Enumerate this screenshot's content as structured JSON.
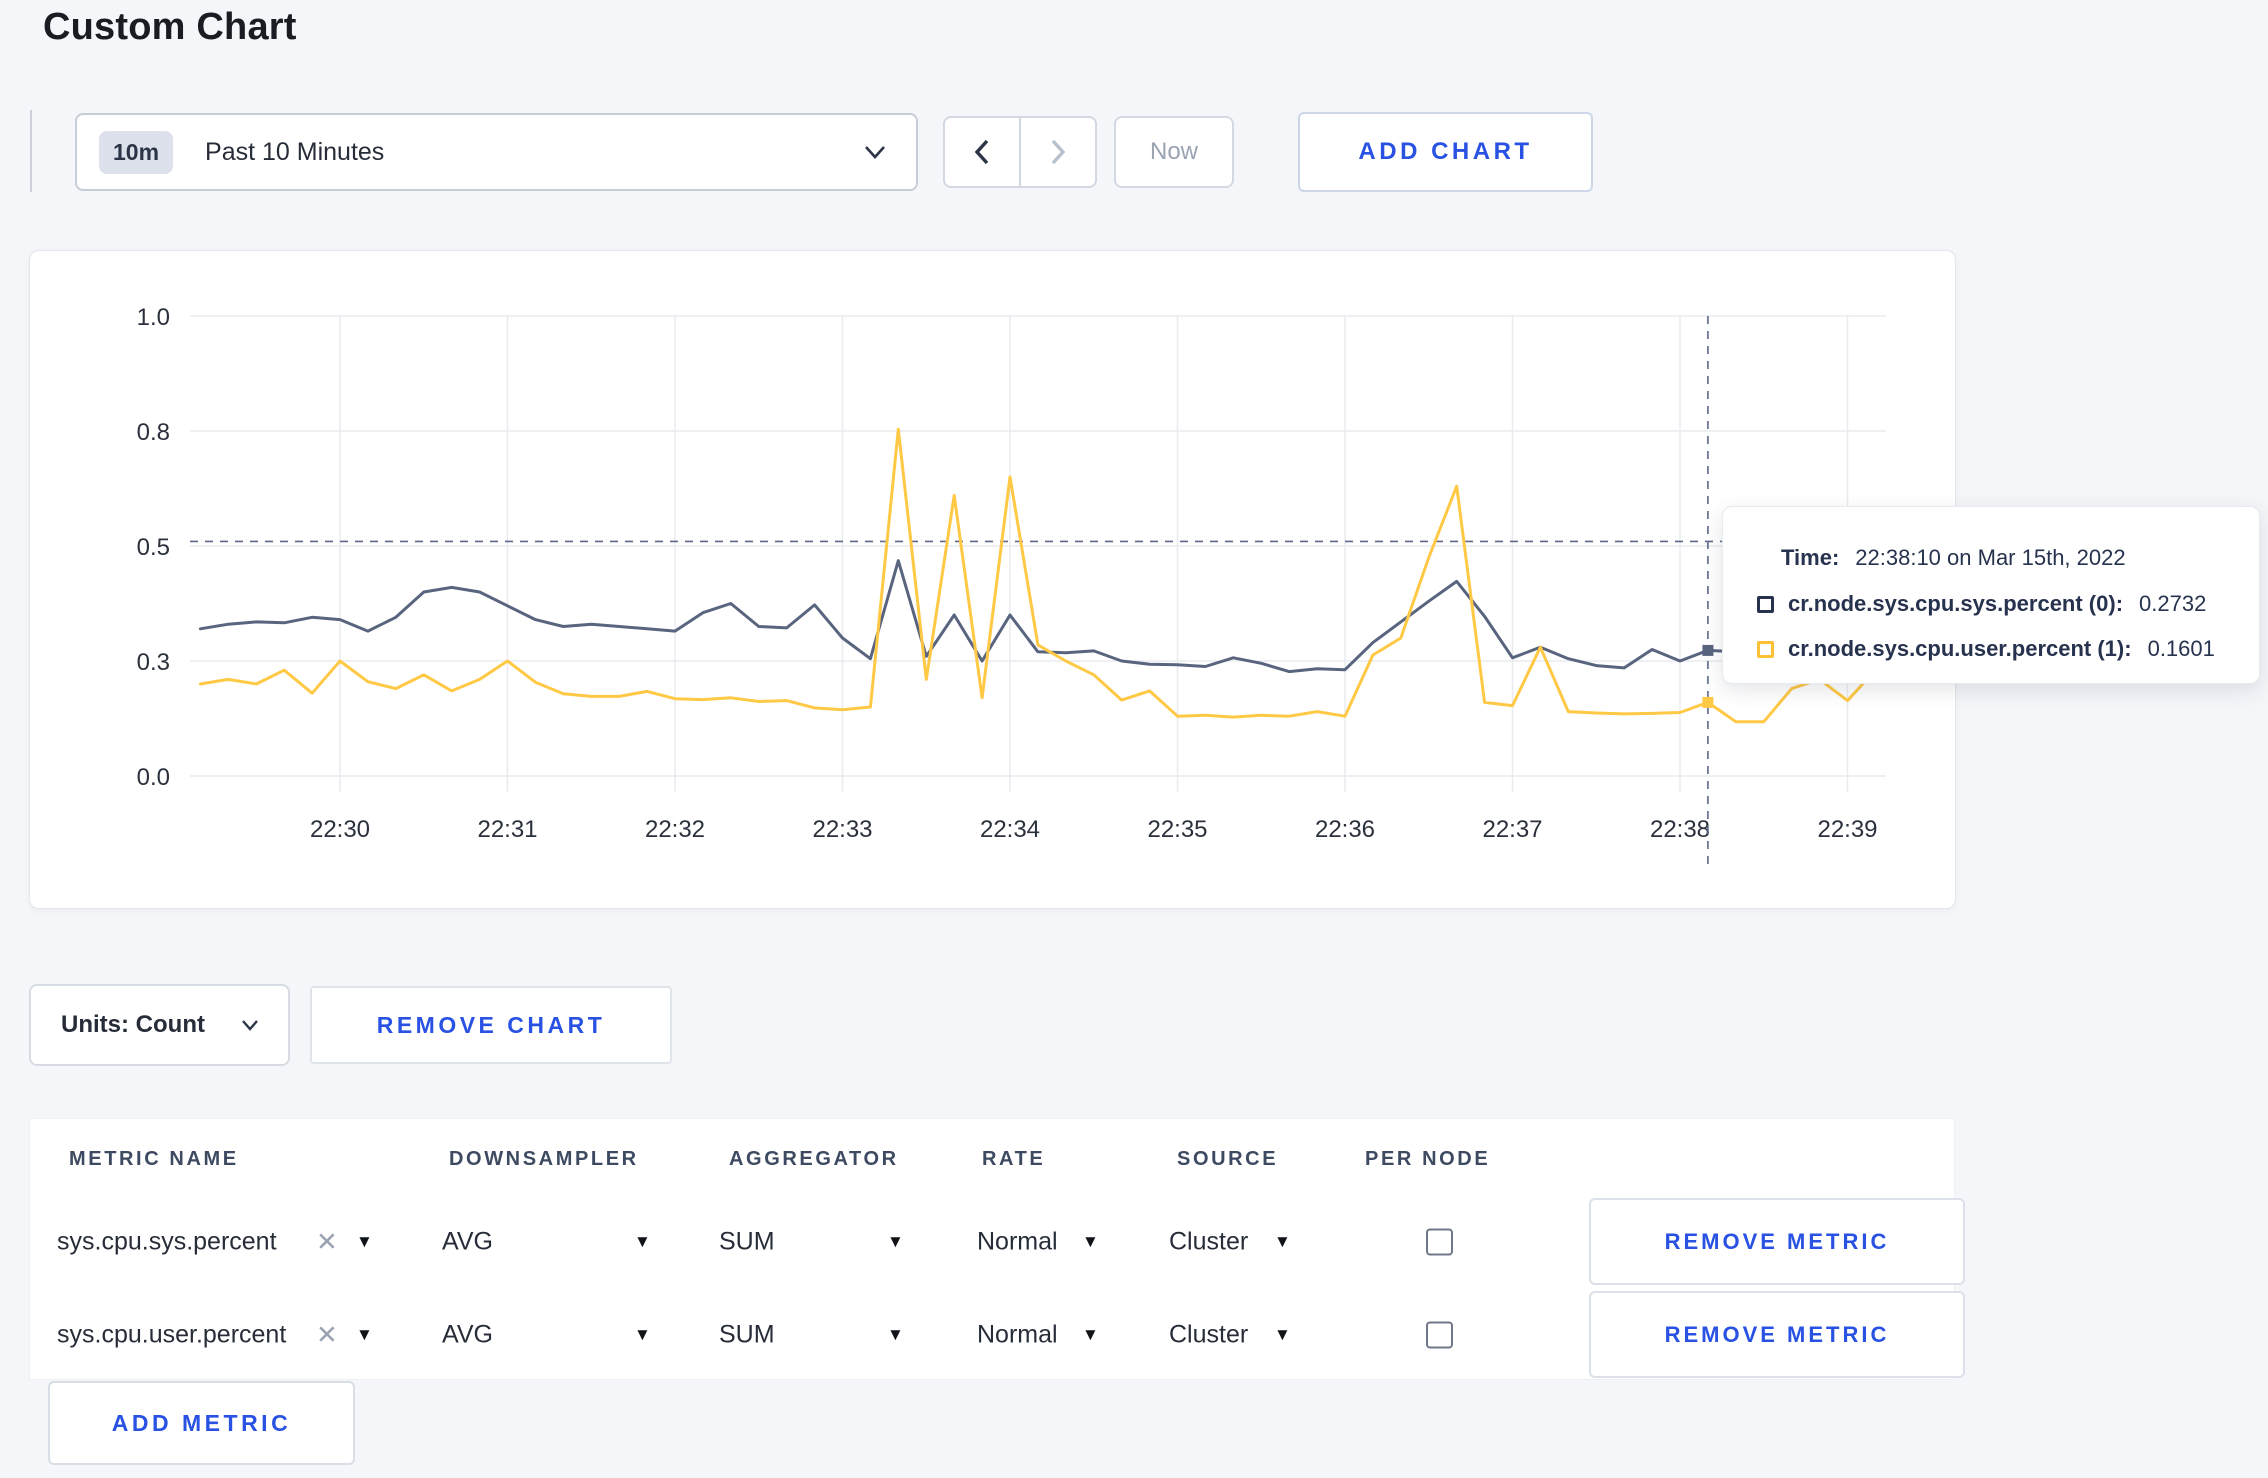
{
  "page": {
    "title": "Custom Chart"
  },
  "toolbar": {
    "time_badge": "10m",
    "time_label": "Past 10 Minutes",
    "now_label": "Now",
    "add_chart_label": "ADD CHART",
    "icons": {
      "prev": "chevron-left",
      "next": "chevron-right",
      "open": "chevron-down"
    }
  },
  "units_bar": {
    "units_label": "Units: Count",
    "remove_chart_label": "REMOVE CHART"
  },
  "chart_data": {
    "type": "line",
    "title": "",
    "xlabel": "",
    "ylabel": "",
    "ylim": [
      0,
      1
    ],
    "grid": true,
    "x_axis": {
      "labels": [
        "22:30",
        "22:31",
        "22:32",
        "22:33",
        "22:34",
        "22:35",
        "22:36",
        "22:37",
        "22:38",
        "22:39"
      ]
    },
    "y_axis": {
      "ticks": [
        {
          "label": "1.0",
          "value": 1.0
        },
        {
          "label": "0.8",
          "value": 0.75
        },
        {
          "label": "0.5",
          "value": 0.5
        },
        {
          "label": "0.3",
          "value": 0.25
        },
        {
          "label": "0.0",
          "value": 0.0
        }
      ]
    },
    "sample_interval_seconds": 10,
    "start_time": "22:29:10",
    "crosshair": {
      "index": 54,
      "time": "22:38:10",
      "hline_value": 0.51
    },
    "series": [
      {
        "key": "sys",
        "name": "cr.node.sys.cpu.sys.percent (0)",
        "color": "#59647e",
        "values": [
          0.32,
          0.33,
          0.335,
          0.333,
          0.345,
          0.34,
          0.315,
          0.345,
          0.4,
          0.41,
          0.4,
          0.37,
          0.34,
          0.325,
          0.33,
          0.325,
          0.32,
          0.315,
          0.355,
          0.375,
          0.325,
          0.322,
          0.372,
          0.3,
          0.255,
          0.468,
          0.26,
          0.35,
          0.25,
          0.35,
          0.27,
          0.268,
          0.272,
          0.25,
          0.243,
          0.242,
          0.238,
          0.257,
          0.245,
          0.227,
          0.233,
          0.231,
          0.29,
          0.335,
          0.38,
          0.423,
          0.347,
          0.257,
          0.28,
          0.255,
          0.24,
          0.235,
          0.275,
          0.25,
          0.273,
          0.27,
          0.27,
          0.28,
          0.29,
          0.3,
          0.31
        ]
      },
      {
        "key": "user",
        "name": "cr.node.sys.cpu.user.percent (1)",
        "color": "#ffc845",
        "values": [
          0.2,
          0.21,
          0.2,
          0.23,
          0.18,
          0.25,
          0.205,
          0.19,
          0.22,
          0.185,
          0.21,
          0.25,
          0.204,
          0.179,
          0.173,
          0.173,
          0.184,
          0.168,
          0.166,
          0.17,
          0.162,
          0.164,
          0.148,
          0.144,
          0.15,
          0.754,
          0.21,
          0.61,
          0.17,
          0.65,
          0.285,
          0.25,
          0.22,
          0.165,
          0.185,
          0.13,
          0.132,
          0.128,
          0.132,
          0.13,
          0.14,
          0.13,
          0.263,
          0.3,
          0.475,
          0.63,
          0.16,
          0.153,
          0.28,
          0.14,
          0.137,
          0.135,
          0.136,
          0.138,
          0.16,
          0.118,
          0.118,
          0.19,
          0.21,
          0.164,
          0.23
        ]
      }
    ],
    "legend_position": "tooltip"
  },
  "tooltip": {
    "time_label": "Time:",
    "time_value": "22:38:10 on Mar 15th, 2022",
    "rows": [
      {
        "name": "cr.node.sys.cpu.sys.percent (0):",
        "value": "0.2732",
        "color": "#27334e"
      },
      {
        "name": "cr.node.sys.cpu.user.percent (1):",
        "value": "0.1601",
        "color": "#fdc136"
      }
    ]
  },
  "metrics_table": {
    "headers": [
      "METRIC NAME",
      "DOWNSAMPLER",
      "AGGREGATOR",
      "RATE",
      "SOURCE",
      "PER NODE"
    ],
    "rows": [
      {
        "metric": "sys.cpu.sys.percent",
        "downsampler": "AVG",
        "aggregator": "SUM",
        "rate": "Normal",
        "source": "Cluster",
        "per_node_checked": false,
        "remove_label": "REMOVE METRIC"
      },
      {
        "metric": "sys.cpu.user.percent",
        "downsampler": "AVG",
        "aggregator": "SUM",
        "rate": "Normal",
        "source": "Cluster",
        "per_node_checked": false,
        "remove_label": "REMOVE METRIC"
      }
    ],
    "add_metric_label": "ADD METRIC"
  }
}
